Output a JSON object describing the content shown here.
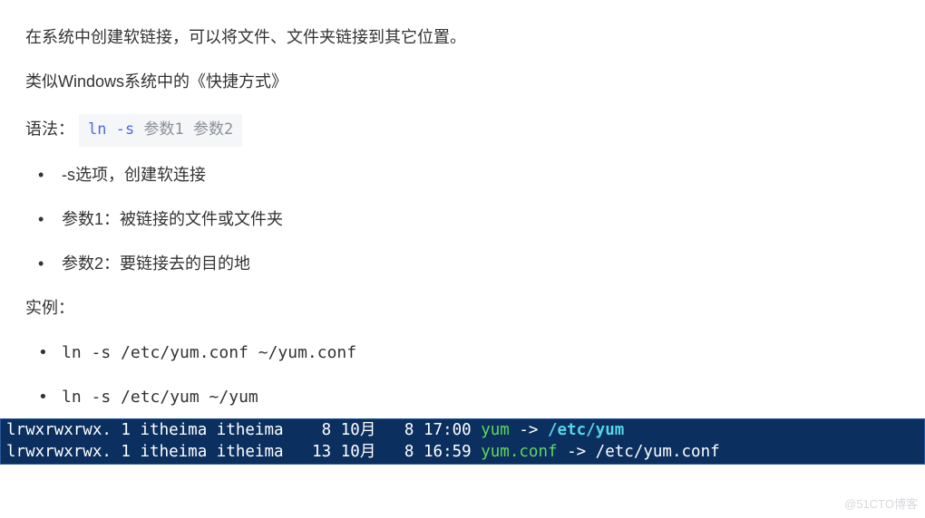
{
  "intro1": "在系统中创建软链接，可以将文件、文件夹链接到其它位置。",
  "intro2": "类似Windows系统中的《快捷方式》",
  "syntax_label": "语法：",
  "syntax": {
    "cmd": "ln",
    "flag": "-s",
    "arg1": "参数1",
    "arg2": "参数2"
  },
  "opt_s": "-s选项，创建软连接",
  "opt_p1": "参数1：被链接的文件或文件夹",
  "opt_p2": "参数2：要链接去的目的地",
  "examples_label": "实例：",
  "ex1": "ln -s /etc/yum.conf ~/yum.conf",
  "ex2": "ln -s /etc/yum ~/yum",
  "term1": {
    "meta": "lrwxrwxrwx. 1 itheima itheima    8 10月   8 17:00 ",
    "name": "yum",
    "arrow": " -> ",
    "target": "/etc/yum"
  },
  "term2": {
    "meta": "lrwxrwxrwx. 1 itheima itheima   13 10月   8 16:59 ",
    "name": "yum.conf",
    "arrow": " -> /etc/yum.conf"
  },
  "watermark": "@51CTO博客"
}
